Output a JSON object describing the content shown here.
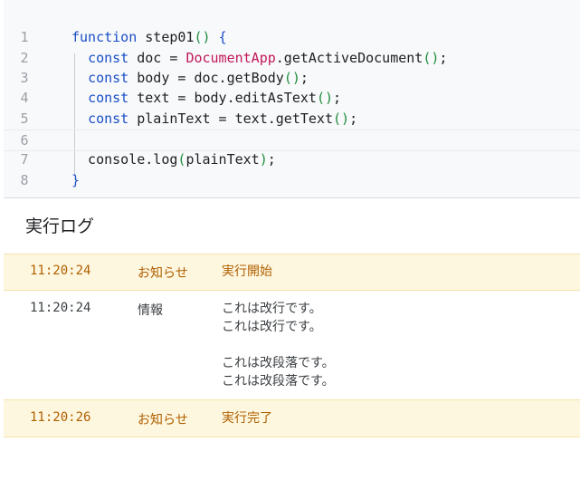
{
  "editor": {
    "lines": [
      {
        "n": "1",
        "tokens": [
          [
            "kw",
            "function"
          ],
          [
            "t",
            " step01"
          ],
          [
            "paren",
            "()"
          ],
          [
            "t",
            " "
          ],
          [
            "kw",
            "{"
          ]
        ]
      },
      {
        "n": "2",
        "tokens": [
          [
            "t",
            "  "
          ],
          [
            "kw",
            "const"
          ],
          [
            "t",
            " doc = "
          ],
          [
            "cls",
            "DocumentApp"
          ],
          [
            "t",
            ".getActiveDocument"
          ],
          [
            "paren",
            "()"
          ],
          [
            "t",
            ";"
          ]
        ]
      },
      {
        "n": "3",
        "tokens": [
          [
            "t",
            "  "
          ],
          [
            "kw",
            "const"
          ],
          [
            "t",
            " body = doc.getBody"
          ],
          [
            "paren",
            "()"
          ],
          [
            "t",
            ";"
          ]
        ]
      },
      {
        "n": "4",
        "tokens": [
          [
            "t",
            "  "
          ],
          [
            "kw",
            "const"
          ],
          [
            "t",
            " text = body.editAsText"
          ],
          [
            "paren",
            "()"
          ],
          [
            "t",
            ";"
          ]
        ]
      },
      {
        "n": "5",
        "tokens": [
          [
            "t",
            "  "
          ],
          [
            "kw",
            "const"
          ],
          [
            "t",
            " plainText = text.getText"
          ],
          [
            "paren",
            "()"
          ],
          [
            "t",
            ";"
          ]
        ]
      },
      {
        "n": "6",
        "tokens": []
      },
      {
        "n": "7",
        "tokens": [
          [
            "t",
            "  console.log"
          ],
          [
            "paren",
            "("
          ],
          [
            "t",
            "plainText"
          ],
          [
            "paren",
            ")"
          ],
          [
            "t",
            ";"
          ]
        ]
      },
      {
        "n": "8",
        "tokens": [
          [
            "kw",
            "}"
          ]
        ]
      }
    ]
  },
  "log": {
    "title": "実行ログ",
    "entries": [
      {
        "time": "11:20:24",
        "level": "お知らせ",
        "kind": "notice",
        "lines": [
          "実行開始"
        ]
      },
      {
        "time": "11:20:24",
        "level": "情報",
        "kind": "info",
        "lines": [
          "これは改行です。",
          "これは改行です。",
          "",
          "これは改段落です。",
          "これは改段落です。"
        ]
      },
      {
        "time": "11:20:26",
        "level": "お知らせ",
        "kind": "notice",
        "lines": [
          "実行完了"
        ]
      }
    ]
  }
}
